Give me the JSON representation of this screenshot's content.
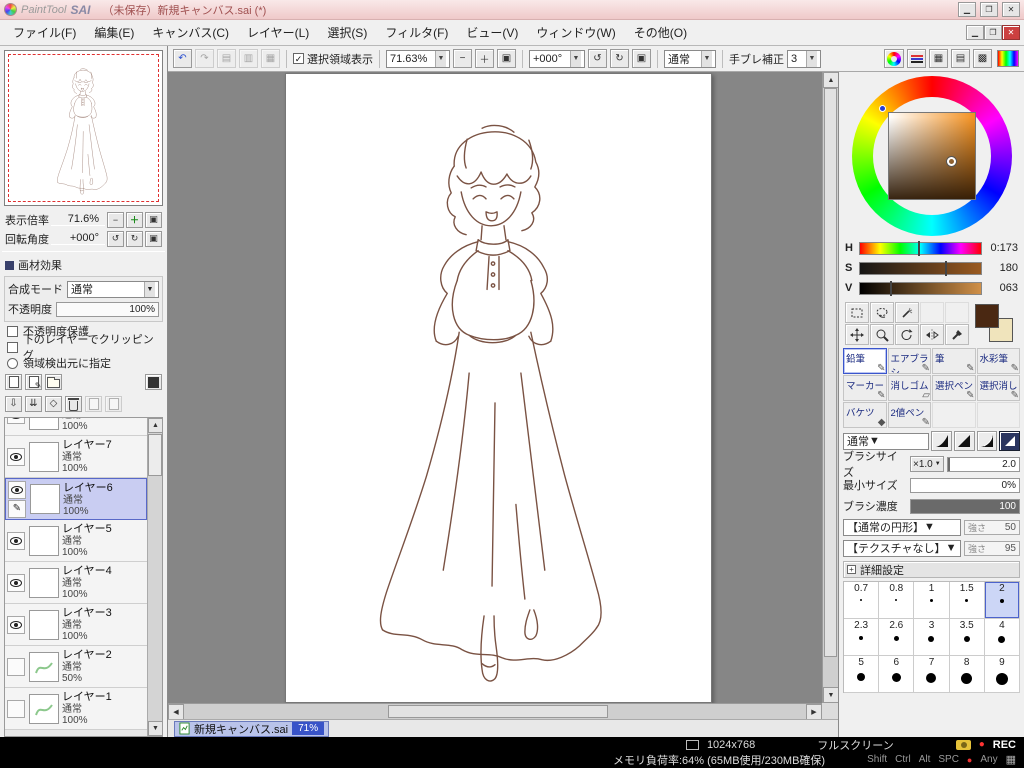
{
  "titlebar": {
    "logo_paint": "PaintTool",
    "logo_sai": "SAI",
    "title": "（未保存）新規キャンバス.sai (*)"
  },
  "menubar": {
    "items": [
      "ファイル(F)",
      "編集(E)",
      "キャンバス(C)",
      "レイヤー(L)",
      "選択(S)",
      "フィルタ(F)",
      "ビュー(V)",
      "ウィンドウ(W)",
      "その他(O)"
    ]
  },
  "toolbar": {
    "show_selection": "選択領域表示",
    "zoom": "71.63%",
    "angle": "+000°",
    "blend": "通常",
    "stabilizer_label": "手ブレ補正",
    "stabilizer": "3"
  },
  "navigator": {
    "scale_label": "表示倍率",
    "scale": "71.6%",
    "rotation_label": "回転角度",
    "rotation": "+000°"
  },
  "material": {
    "header": "画材効果",
    "blend_label": "合成モード",
    "blend": "通常",
    "opacity_label": "不透明度",
    "opacity": "100%",
    "options": [
      "不透明度保護",
      "下のレイヤーでクリッピング",
      "領域検出元に指定"
    ]
  },
  "layers": {
    "items": [
      {
        "name": "",
        "mode": "通常",
        "opacity": "100%"
      },
      {
        "name": "レイヤー7",
        "mode": "通常",
        "opacity": "100%"
      },
      {
        "name": "レイヤー6",
        "mode": "通常",
        "opacity": "100%"
      },
      {
        "name": "レイヤー5",
        "mode": "通常",
        "opacity": "100%"
      },
      {
        "name": "レイヤー4",
        "mode": "通常",
        "opacity": "100%"
      },
      {
        "name": "レイヤー3",
        "mode": "通常",
        "opacity": "100%"
      },
      {
        "name": "レイヤー2",
        "mode": "通常",
        "opacity": "50%"
      },
      {
        "name": "レイヤー1",
        "mode": "通常",
        "opacity": "100%"
      }
    ]
  },
  "canvas": {
    "tab_name": "新規キャンバス.sai",
    "tab_zoom": "71%"
  },
  "color": {
    "h_label": "H",
    "h_value": "0:173",
    "s_label": "S",
    "s_value": "180",
    "v_label": "V",
    "v_value": "063",
    "primary": "#4a2812",
    "secondary": "#f0e4bc"
  },
  "tools": {
    "items": [
      "鉛筆",
      "エアブラシ",
      "筆",
      "水彩筆",
      "マーカー",
      "消しゴム",
      "選択ペン",
      "選択消し",
      "バケツ",
      "2値ペン"
    ],
    "selected": "鉛筆"
  },
  "brush": {
    "edge_mode": "通常",
    "size_label": "ブラシサイズ",
    "size_unit": "×1.0",
    "size_value": "2.0",
    "min_label": "最小サイズ",
    "min_value": "0%",
    "density_label": "ブラシ濃度",
    "density_value": "100",
    "shape_name": "【通常の円形】",
    "shape_strength_label": "強さ",
    "shape_strength": "50",
    "texture_name": "【テクスチャなし】",
    "texture_strength_label": "強さ",
    "texture_strength": "95",
    "advanced_header": "詳細設定",
    "presets": [
      "0.7",
      "0.8",
      "1",
      "1.5",
      "2",
      "2.3",
      "2.6",
      "3",
      "3.5",
      "4",
      "5",
      "6",
      "7",
      "8",
      "9"
    ],
    "preset_selected": "2"
  },
  "statusbar": {
    "resolution": "1024x768",
    "fullscreen": "フルスクリーン",
    "rec": "REC",
    "memory": "メモリ負荷率:64% (65MB使用/230MB確保)",
    "keys": [
      "Shift",
      "Ctrl",
      "Alt",
      "SPC"
    ],
    "any": "Any"
  }
}
